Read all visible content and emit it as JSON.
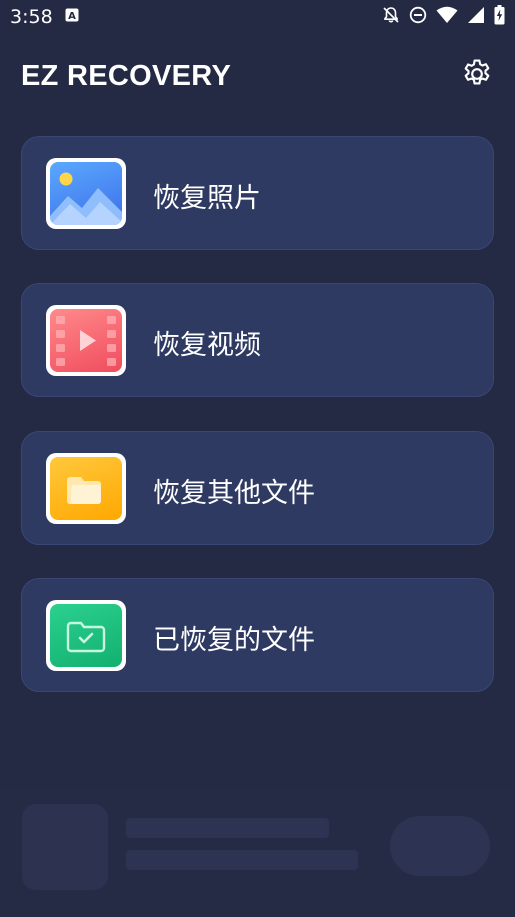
{
  "status_bar": {
    "time": "3:58",
    "icons": [
      "a-notification-icon",
      "notifications-off-icon",
      "do-not-disturb-icon",
      "wifi-icon",
      "signal-icon",
      "battery-charging-icon"
    ]
  },
  "header": {
    "title": "EZ RECOVERY",
    "settings_icon": "gear-icon"
  },
  "menu": {
    "items": [
      {
        "label": "恢复照片",
        "icon": "photo-icon",
        "color": "#4b86f2"
      },
      {
        "label": "恢复视频",
        "icon": "video-icon",
        "color": "#f4646e"
      },
      {
        "label": "恢复其他文件",
        "icon": "folder-icon",
        "color": "#ffb300"
      },
      {
        "label": "已恢复的文件",
        "icon": "recovered-folder-icon",
        "color": "#1fbf7f"
      }
    ]
  },
  "colors": {
    "background": "#252a44",
    "card": "#2e3a62"
  }
}
